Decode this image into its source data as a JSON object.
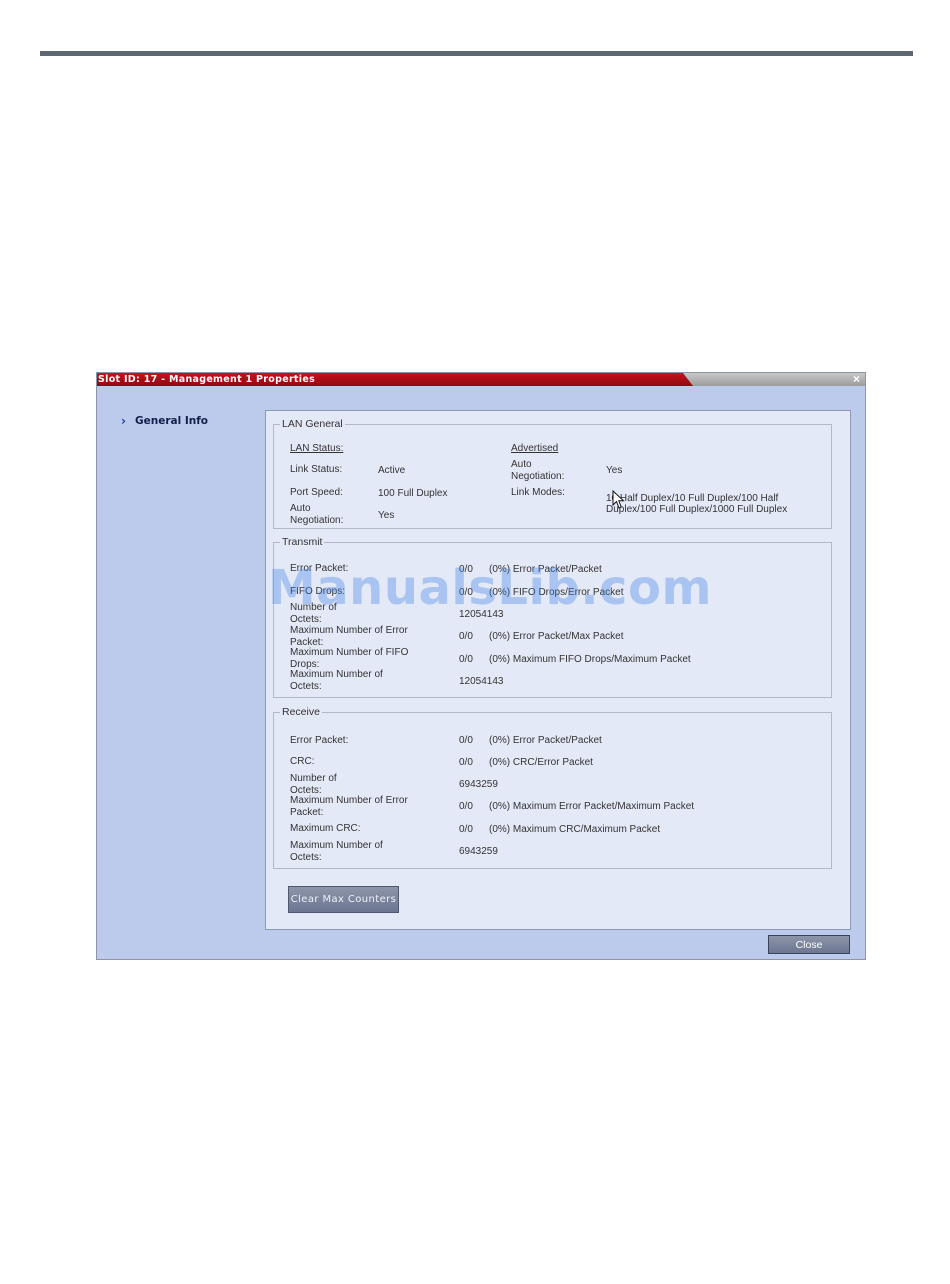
{
  "dialog": {
    "title": "Slot ID: 17 - Management 1 Properties",
    "close_glyph": "×",
    "nav": {
      "general_info": "General Info",
      "chevron": "›"
    },
    "lan_general": {
      "legend": "LAN General",
      "lan_status_heading": "LAN Status:",
      "advertised_heading": "Advertised",
      "link_status_label": "Link Status:",
      "link_status_value": "Active",
      "port_speed_label": "Port Speed:",
      "port_speed_value": "100 Full Duplex",
      "auto_neg_label_1": "Auto",
      "auto_neg_label_2": "Negotiation:",
      "auto_neg_value": "Yes",
      "adv_auto_neg_label_1": "Auto",
      "adv_auto_neg_label_2": "Negotiation:",
      "adv_auto_neg_value": "Yes",
      "link_modes_label": "Link Modes:",
      "link_modes_value_1": "10 Half Duplex/10 Full Duplex/100 Half",
      "link_modes_value_2": "Duplex/100 Full Duplex/1000 Full Duplex"
    },
    "transmit": {
      "legend": "Transmit",
      "rows": [
        {
          "label": "Error Packet:",
          "value": "0/0",
          "desc": "(0%) Error Packet/Packet"
        },
        {
          "label": "FIFO Drops:",
          "value": "0/0",
          "desc": "(0%) FIFO Drops/Error Packet"
        },
        {
          "label_1": "Number of",
          "label_2": "Octets:",
          "value": "12054143"
        },
        {
          "label_1": "Maximum Number of Error",
          "label_2": "Packet:",
          "value": "0/0",
          "desc": "(0%) Error Packet/Max Packet"
        },
        {
          "label_1": "Maximum Number of FIFO",
          "label_2": "Drops:",
          "value": "0/0",
          "desc": "(0%) Maximum FIFO Drops/Maximum Packet"
        },
        {
          "label_1": "Maximum Number of",
          "label_2": "Octets:",
          "value": "12054143"
        }
      ]
    },
    "receive": {
      "legend": "Receive",
      "rows": [
        {
          "label": "Error Packet:",
          "value": "0/0",
          "desc": "(0%) Error Packet/Packet"
        },
        {
          "label": "CRC:",
          "value": "0/0",
          "desc": "(0%) CRC/Error Packet"
        },
        {
          "label_1": "Number of",
          "label_2": "Octets:",
          "value": "6943259"
        },
        {
          "label_1": "Maximum Number of Error",
          "label_2": "Packet:",
          "value": "0/0",
          "desc": "(0%) Maximum Error Packet/Maximum Packet"
        },
        {
          "label": "Maximum CRC:",
          "value": "0/0",
          "desc": "(0%) Maximum CRC/Maximum Packet"
        },
        {
          "label_1": "Maximum Number of",
          "label_2": "Octets:",
          "value": "6943259"
        }
      ]
    },
    "buttons": {
      "clear_max_counters": "Clear Max Counters",
      "close": "Close"
    }
  },
  "watermark": "ManualsLib.com",
  "icons": {
    "cursor": "mouse-pointer-icon"
  }
}
